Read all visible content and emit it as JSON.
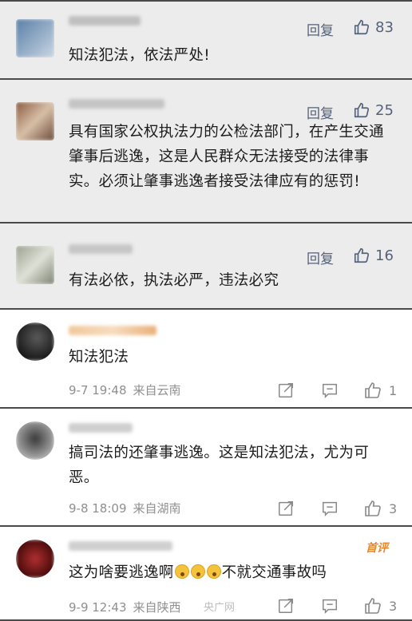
{
  "comments": [
    {
      "text": "知法犯法，依法严处!",
      "reply_label": "回复",
      "likes": "83"
    },
    {
      "text": "具有国家公权执法力的公检法部门，在产生交通肇事后逃逸，这是人民群众无法接受的法律事实。必须让肇事逃逸者接受法律应有的惩罚!",
      "reply_label": "回复",
      "likes": "25"
    },
    {
      "text": "有法必依，执法必严，违法必究",
      "reply_label": "回复",
      "likes": "16"
    },
    {
      "text": "知法犯法",
      "date": "9-7 19:48",
      "location": "来自云南",
      "likes": "1"
    },
    {
      "text": "搞司法的还肇事逃逸。这是知法犯法，尤为可恶。",
      "date": "9-8 18:09",
      "location": "来自湖南",
      "likes": "3"
    },
    {
      "text_before": "这为啥要逃逸啊",
      "text_after": "不就交通事故吗",
      "date": "9-9 12:43",
      "location": "来自陕西",
      "likes": "3",
      "badge": "首评"
    }
  ],
  "watermark": "央广网",
  "icons": {
    "like": "thumbs-up-icon",
    "share": "share-icon",
    "comment": "comment-icon"
  },
  "colors": {
    "action_blue": "#55627a",
    "meta_gray": "#8f8f8f",
    "badge_orange": "#e8862a",
    "gray_card": "#ececec"
  }
}
